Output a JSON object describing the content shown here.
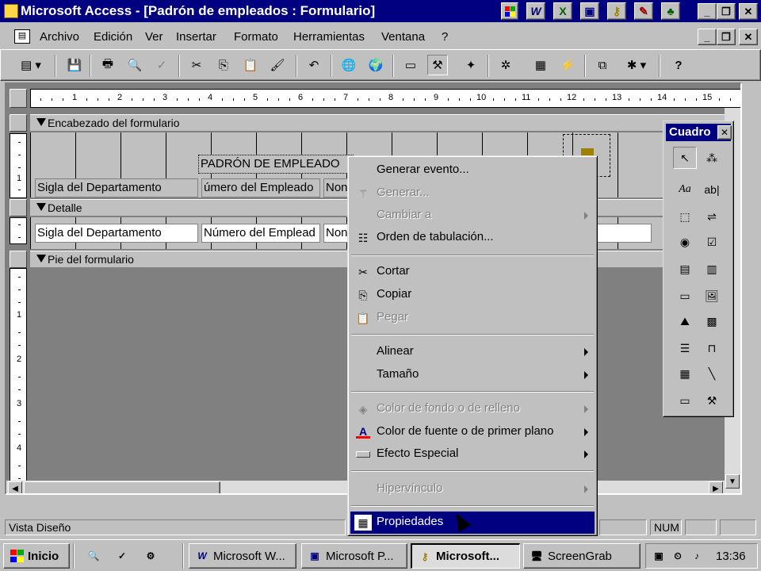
{
  "window": {
    "title": "Microsoft Access - [Padrón de empleados : Formulario]"
  },
  "menubar": {
    "items": [
      "Archivo",
      "Edición",
      "Ver",
      "Insertar",
      "Formato",
      "Herramientas",
      "Ventana",
      "?"
    ]
  },
  "ruler": {
    "labels": [
      "1",
      "2",
      "3",
      "4",
      "5",
      "6",
      "7",
      "8",
      "9",
      "10",
      "11",
      "12",
      "13",
      "14",
      "15"
    ],
    "vertical_labels": [
      "1",
      "1",
      "2",
      "3",
      "4"
    ]
  },
  "sections": {
    "header": "Encabezado del formulario",
    "detail": "Detalle",
    "footer": "Pie del formulario"
  },
  "form": {
    "title_label": "PADRÓN DE EMPLEADO",
    "header_labels": [
      "Sigla del Departamento",
      "úmero del Empleado",
      "Non"
    ],
    "detail_fields": [
      "Sigla del Departamento",
      "Número del Emplead",
      "Non"
    ]
  },
  "context_menu": {
    "items": [
      {
        "label": "Generar evento...",
        "enabled": true,
        "submenu": false,
        "icon": ""
      },
      {
        "label": "Generar...",
        "enabled": false,
        "submenu": false,
        "icon": "wand-icon"
      },
      {
        "label": "Cambiar a",
        "enabled": false,
        "submenu": true,
        "icon": ""
      },
      {
        "label": "Orden de tabulación...",
        "enabled": true,
        "submenu": false,
        "icon": "tab-order-icon"
      },
      {
        "label": "Cortar",
        "enabled": true,
        "submenu": false,
        "icon": "scissors-icon"
      },
      {
        "label": "Copiar",
        "enabled": true,
        "submenu": false,
        "icon": "copy-icon"
      },
      {
        "label": "Pegar",
        "enabled": false,
        "submenu": false,
        "icon": "paste-icon"
      },
      {
        "label": "Alinear",
        "enabled": true,
        "submenu": true,
        "icon": ""
      },
      {
        "label": "Tamaño",
        "enabled": true,
        "submenu": true,
        "icon": ""
      },
      {
        "label": "Color de fondo o de relleno",
        "enabled": false,
        "submenu": true,
        "icon": "fill-color-icon"
      },
      {
        "label": "Color de fuente o de primer plano",
        "enabled": true,
        "submenu": true,
        "icon": "font-color-icon"
      },
      {
        "label": "Efecto Especial",
        "enabled": true,
        "submenu": true,
        "icon": "special-effect-icon"
      },
      {
        "label": "Hipervínculo",
        "enabled": false,
        "submenu": true,
        "icon": ""
      },
      {
        "label": "Propiedades",
        "enabled": true,
        "submenu": false,
        "icon": "properties-icon",
        "highlighted": true
      }
    ]
  },
  "toolbox": {
    "title": "Cuadro"
  },
  "statusbar": {
    "mode": "Vista Diseño",
    "num": "NUM"
  },
  "taskbar": {
    "start": "Inicio",
    "tasks": [
      "Microsoft W...",
      "Microsoft P...",
      "Microsoft...",
      "ScreenGrab"
    ],
    "clock": "13:36"
  },
  "colors": {
    "titlebar": "#000080",
    "face": "#c0c0c0",
    "highlight": "#000080",
    "design_bg": "#808080"
  }
}
